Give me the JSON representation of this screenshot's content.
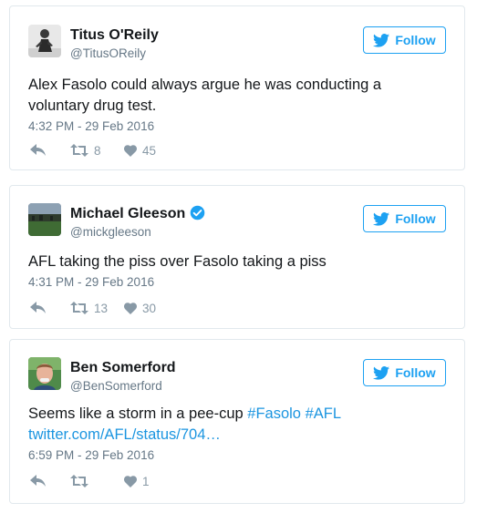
{
  "tweets": [
    {
      "name": "Titus O'Reily",
      "handle": "@TitusOReily",
      "verified": false,
      "follow_label": "Follow",
      "text": "Alex Fasolo could always argue he was conducting a voluntary drug test.",
      "time": "4:32 PM - 29 Feb 2016",
      "retweets": "8",
      "likes": "45"
    },
    {
      "name": "Michael Gleeson",
      "handle": "@mickgleeson",
      "verified": true,
      "follow_label": "Follow",
      "text": "AFL taking the piss over Fasolo taking a piss",
      "time": "4:31 PM - 29 Feb 2016",
      "retweets": "13",
      "likes": "30"
    },
    {
      "name": "Ben Somerford",
      "handle": "@BenSomerford",
      "verified": false,
      "follow_label": "Follow",
      "text_prefix": "Seems like a storm in a pee-cup ",
      "hashtag1": "#Fasolo",
      "hashtag2": "#AFL",
      "link": "twitter.com/AFL/status/704…",
      "time": "6:59 PM - 29 Feb 2016",
      "retweets": "",
      "likes": "1"
    }
  ],
  "colors": {
    "accent": "#1da1f2",
    "link": "#1b95e0",
    "muted": "#657786",
    "icon": "#8899a6",
    "border": "#e1e8ed"
  },
  "icons": {
    "follow": "follow-bird-icon",
    "verified": "verified-badge-icon",
    "reply": "reply-icon",
    "retweet": "retweet-icon",
    "like": "heart-icon"
  }
}
